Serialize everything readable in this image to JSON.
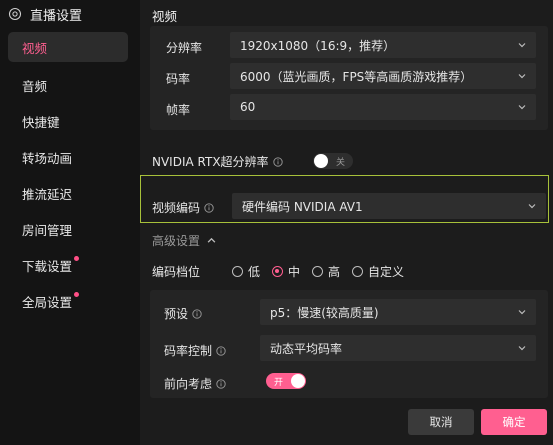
{
  "sidebar": {
    "title": "直播设置",
    "items": [
      {
        "label": "视频",
        "active": true
      },
      {
        "label": "音频"
      },
      {
        "label": "快捷键"
      },
      {
        "label": "转场动画"
      },
      {
        "label": "推流延迟"
      },
      {
        "label": "房间管理"
      },
      {
        "label": "下载设置",
        "badge": true
      },
      {
        "label": "全局设置",
        "badge": true
      }
    ]
  },
  "video": {
    "section_title": "视频",
    "resolution": {
      "label": "分辨率",
      "value": "1920x1080（16:9，推荐）"
    },
    "bitrate": {
      "label": "码率",
      "value": "6000（蓝光画质，FPS等高画质游戏推荐）"
    },
    "framerate": {
      "label": "帧率",
      "value": "60"
    },
    "rtx": {
      "label": "NVIDIA RTX超分辨率",
      "toggle_text": "关"
    },
    "encoder": {
      "label": "视频编码",
      "value": "硬件编码 NVIDIA AV1"
    },
    "advanced_label": "高级设置",
    "encode_level": {
      "label": "编码档位",
      "options": [
        "低",
        "中",
        "高",
        "自定义"
      ],
      "selected": "中"
    },
    "preset": {
      "label": "预设",
      "value": "p5：慢速(较高质量)"
    },
    "rate_control": {
      "label": "码率控制",
      "value": "动态平均码率"
    },
    "lookahead": {
      "label": "前向考虑",
      "toggle_text": "开"
    }
  },
  "buttons": {
    "cancel": "取消",
    "confirm": "确定"
  },
  "colors": {
    "accent": "#ff5f90",
    "highlight": "#a7c13a"
  }
}
